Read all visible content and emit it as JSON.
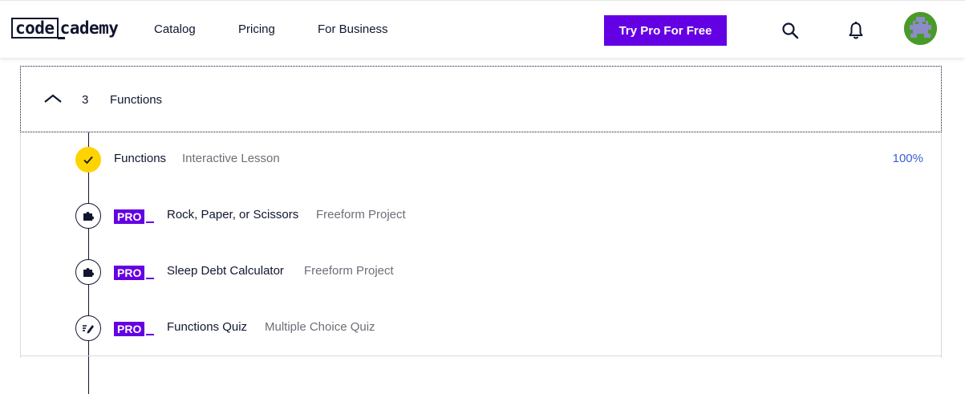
{
  "header": {
    "logo_boxed": "code",
    "logo_rest": "cademy",
    "nav": {
      "catalog": "Catalog",
      "pricing": "Pricing",
      "business": "For Business"
    },
    "cta_label": "Try Pro For Free",
    "icons": [
      "search-icon",
      "bell-icon"
    ],
    "avatar_colors": {
      "background": "#4a9a2a",
      "figure": "#8c8cc8"
    }
  },
  "module": {
    "number": "3",
    "title": "Functions",
    "expanded": true,
    "items": [
      {
        "pro": false,
        "pro_label": "",
        "title": "Functions",
        "type": "Interactive Lesson",
        "completed": true,
        "percent": "100%",
        "icon": "check-icon"
      },
      {
        "pro": true,
        "pro_label": "PRO",
        "title": "Rock, Paper, or Scissors",
        "type": "Freeform Project",
        "completed": false,
        "icon": "puzzle-icon"
      },
      {
        "pro": true,
        "pro_label": "PRO",
        "title": "Sleep Debt Calculator",
        "type": "Freeform Project",
        "completed": false,
        "icon": "puzzle-icon"
      },
      {
        "pro": true,
        "pro_label": "PRO",
        "title": "Functions Quiz",
        "type": "Multiple Choice Quiz",
        "completed": false,
        "icon": "quiz-icon"
      }
    ]
  },
  "colors": {
    "pro_purple": "#6400e4",
    "completed_yellow": "#ffd300",
    "percent_blue": "#3a5fd8",
    "text_navy": "#10162f",
    "muted_gray": "#6e6e78"
  }
}
